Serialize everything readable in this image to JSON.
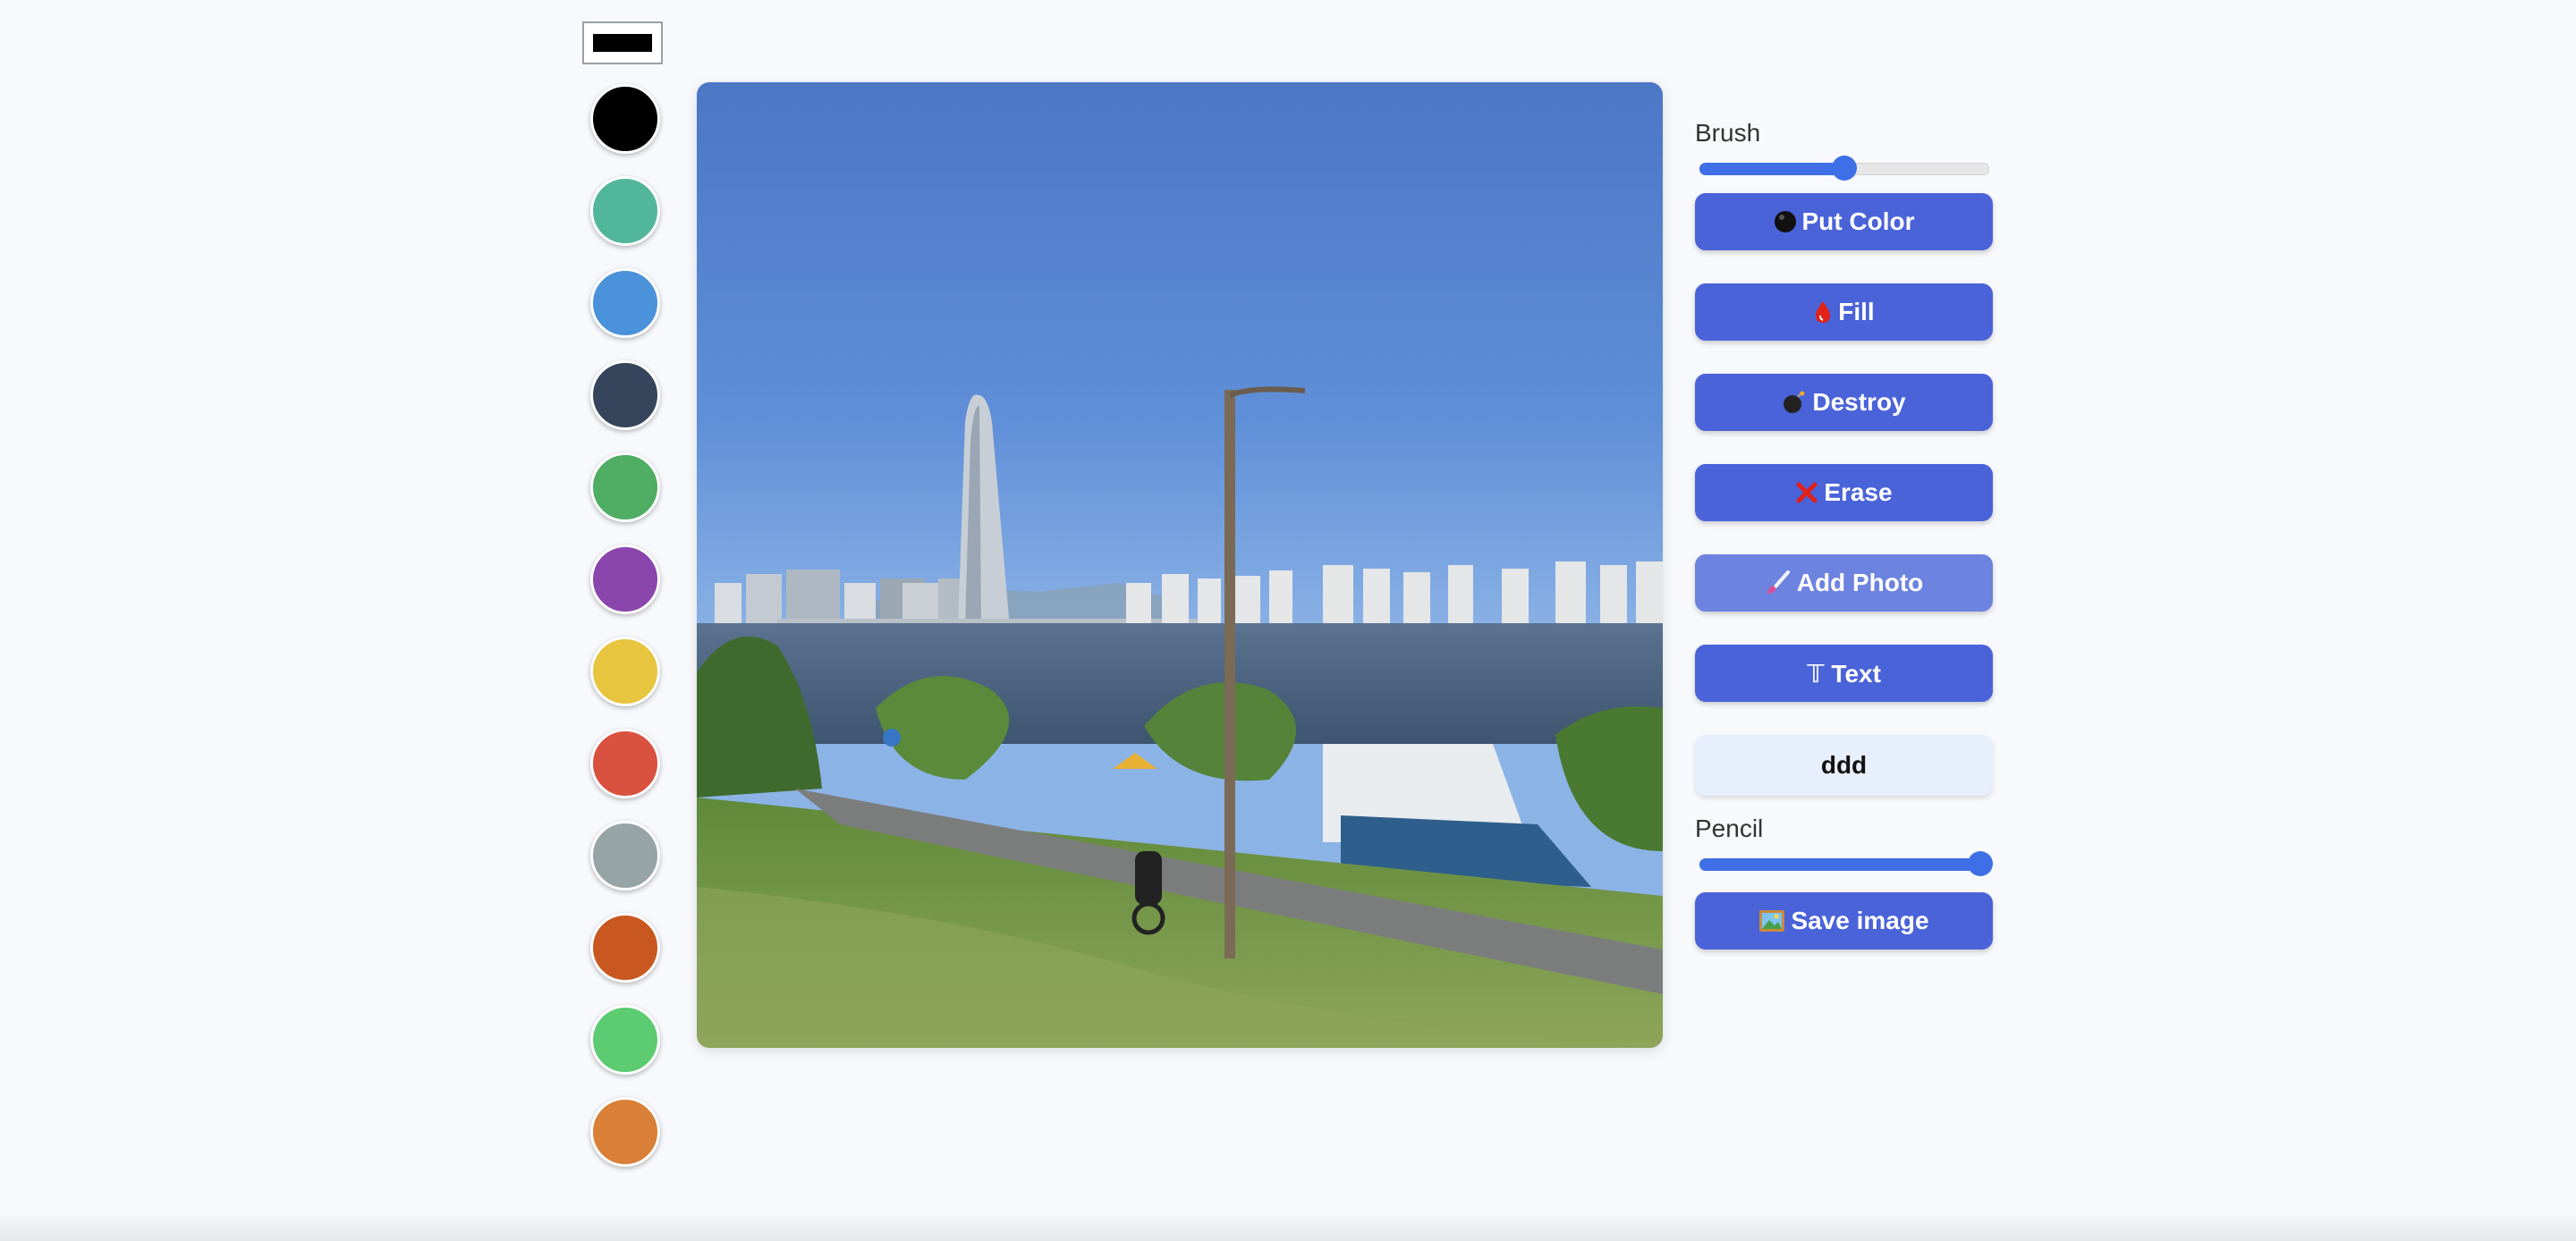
{
  "palette": {
    "selected_color": "#000000",
    "colors": [
      "#000000",
      "#52b69a",
      "#4a92d9",
      "#36455b",
      "#4fae64",
      "#8a46ad",
      "#e8c53f",
      "#d9513f",
      "#97a4a6",
      "#c8581f",
      "#5ccb72",
      "#d97f37"
    ]
  },
  "controls": {
    "brush": {
      "label": "Brush",
      "value_percent": 50
    },
    "pencil": {
      "label": "Pencil",
      "value_percent": 97
    },
    "buttons": {
      "put_color": "Put Color",
      "fill": "Fill",
      "destroy": "Destroy",
      "erase": "Erase",
      "add_photo": "Add Photo",
      "text": "𝕋 Text",
      "save_image": "Save image"
    },
    "text_input_value": "ddd"
  },
  "canvas": {
    "content": "photo"
  }
}
